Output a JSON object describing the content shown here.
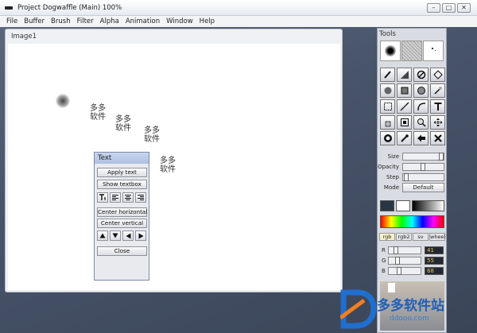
{
  "window": {
    "title": "Project Dogwaffle  (Main)  100%",
    "controls": [
      "–",
      "▢",
      "✕"
    ]
  },
  "menu": [
    "File",
    "Buffer",
    "Brush",
    "Filter",
    "Alpha",
    "Animation",
    "Window",
    "Help"
  ],
  "image_window": {
    "title": "Image1",
    "canvas_texts": [
      "多多\n软件",
      "多多\n软件",
      "多多\n软件",
      "多多\n软件"
    ]
  },
  "text_panel": {
    "title": "Text",
    "apply_text": "Apply text",
    "show_textbox": "Show textbox",
    "center_horizontal": "Center horizontal",
    "center_vertical": "Center vertical",
    "close": "Close"
  },
  "tools_panel": {
    "title": "Tools",
    "size_label": "Size",
    "opacity_label": "Opacity",
    "step_label": "Step",
    "mode_label": "Mode",
    "mode_value": "Default",
    "color_tabs": [
      "rgb",
      "rgb2",
      "sv",
      "wheel"
    ],
    "active_tab": "rgb",
    "current_color": "#293744",
    "rgb": [
      {
        "label": "R",
        "value": "41"
      },
      {
        "label": "G",
        "value": "55"
      },
      {
        "label": "B",
        "value": "68"
      }
    ]
  },
  "watermark": {
    "text": "多多软件站",
    "url": "ddooo.com"
  }
}
